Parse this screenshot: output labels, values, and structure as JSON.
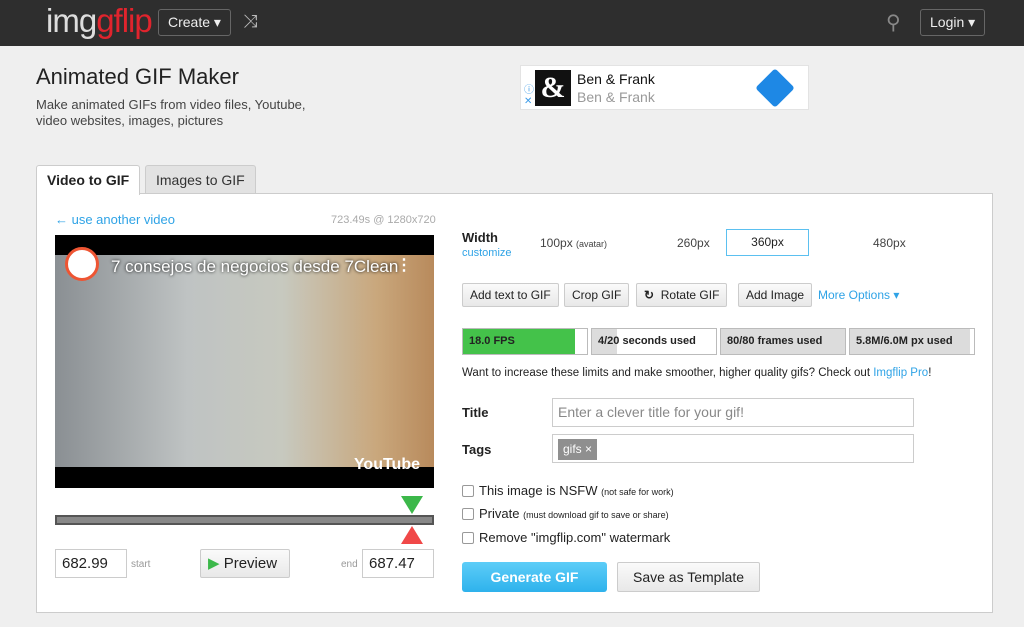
{
  "header": {
    "logo": {
      "img": "img",
      "gif": "g",
      "flip": "flip"
    },
    "create": "Create ▾",
    "shuffle_icon": "shuffle-icon",
    "search_icon": "search-icon",
    "login": "Login ▾"
  },
  "page": {
    "title": "Animated GIF Maker",
    "subtitle": "Make animated GIFs from video files, Youtube, video websites, images, pictures"
  },
  "ad": {
    "logo": "&",
    "title": "Ben & Frank",
    "subtitle": "Ben & Frank",
    "info": "ⓘ",
    "close": "✕"
  },
  "tabs": [
    {
      "label": "Video to GIF",
      "active": true
    },
    {
      "label": "Images to GIF",
      "active": false
    }
  ],
  "video": {
    "back_link": "← use another video",
    "info": "723.49s @ 1280x720",
    "title": "7 consejos de negocios desde 7Clean",
    "youtube": "YouTube",
    "start": "682.99",
    "start_label": "start",
    "end": "687.47",
    "end_label": "end",
    "preview": "Preview"
  },
  "width": {
    "label": "Width",
    "customize": "customize",
    "options": [
      {
        "label": "100px",
        "note": "(avatar)"
      },
      {
        "label": "260px"
      },
      {
        "label": "360px",
        "selected": true
      },
      {
        "label": "480px"
      }
    ]
  },
  "tools": {
    "add_text": "Add text to GIF",
    "crop": "Crop GIF",
    "rotate": "Rotate GIF",
    "add_image": "Add Image",
    "more": "More Options ▾"
  },
  "limits": [
    {
      "label": "18.0 FPS",
      "fill": 0.9,
      "color": "#44c24a"
    },
    {
      "label": "4/20 seconds used",
      "fill": 0.2,
      "color": "#dcdcdc"
    },
    {
      "label": "80/80 frames used",
      "fill": 1.0,
      "color": "#dcdcdc"
    },
    {
      "label": "5.8M/6.0M px used",
      "fill": 0.97,
      "color": "#dcdcdc"
    }
  ],
  "upsell": {
    "text": "Want to increase these limits and make smoother, higher quality gifs? Check out ",
    "link": "Imgflip Pro",
    "end": "!"
  },
  "form": {
    "title_label": "Title",
    "title_placeholder": "Enter a clever title for your gif!",
    "tags_label": "Tags",
    "tag": "gifs ×",
    "nsfw": "This image is NSFW",
    "nsfw_note": "(not safe for work)",
    "private": "Private",
    "private_note": "(must download gif to save or share)",
    "watermark": "Remove \"imgflip.com\" watermark",
    "generate": "Generate GIF",
    "template": "Save as Template"
  }
}
